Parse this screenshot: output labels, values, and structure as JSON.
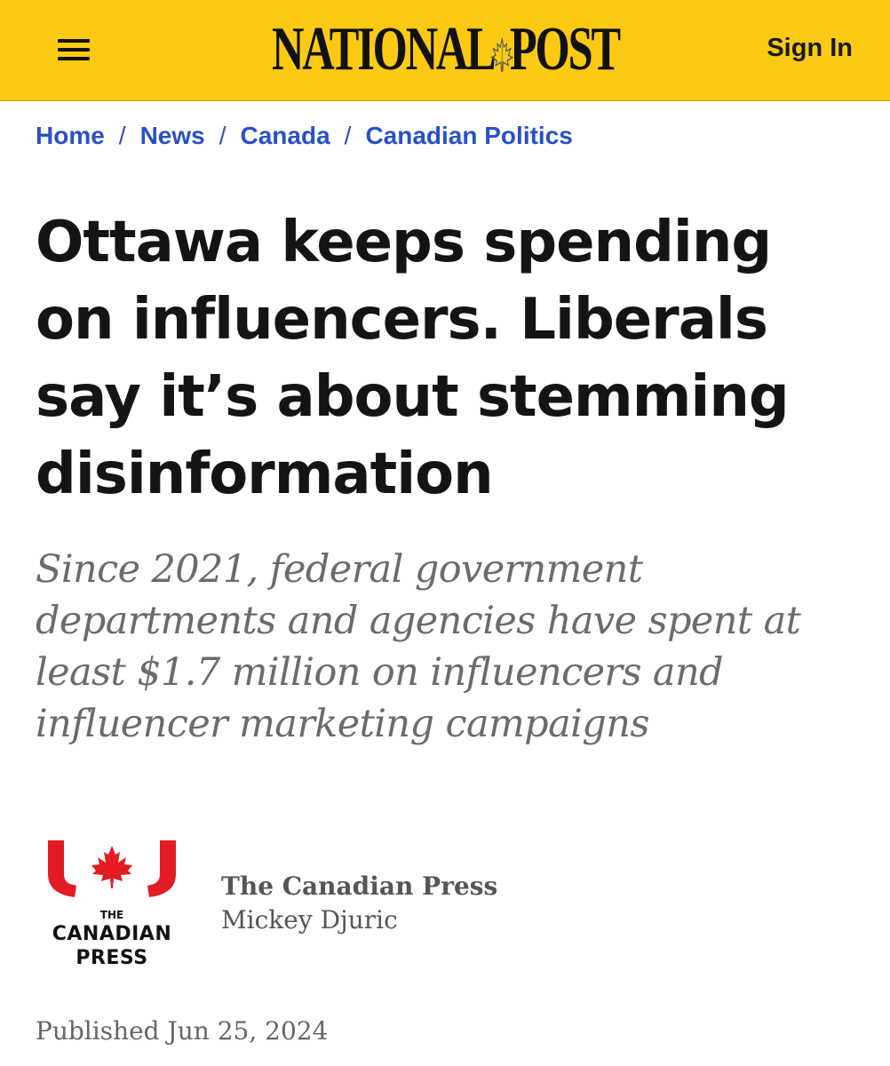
{
  "header": {
    "menu_icon": "hamburger-menu-icon",
    "logo_left": "NATIONAL",
    "logo_right": "POST",
    "logo_icon": "maple-leaf-icon",
    "sign_in_label": "Sign In",
    "background_color": "#fcca14"
  },
  "breadcrumb": {
    "items": [
      {
        "label": "Home"
      },
      {
        "label": "News"
      },
      {
        "label": "Canada"
      },
      {
        "label": "Canadian Politics"
      }
    ],
    "separator": "/",
    "link_color": "#2a50c8"
  },
  "article": {
    "headline": "Ottawa keeps spending on influencers. Liberals say it’s about stemming disinformation",
    "deck": "Since 2021, federal government departments and agencies have spent at least $1.7 million on influencers and influencer marketing campaigns",
    "byline": {
      "logo_line1": "THE",
      "logo_line2": "CANADIAN",
      "logo_line3": "PRESS",
      "logo_accent_color": "#e31b23",
      "organization": "The Canadian Press",
      "author": "Mickey Djuric"
    },
    "published": "Published Jun 25, 2024"
  }
}
